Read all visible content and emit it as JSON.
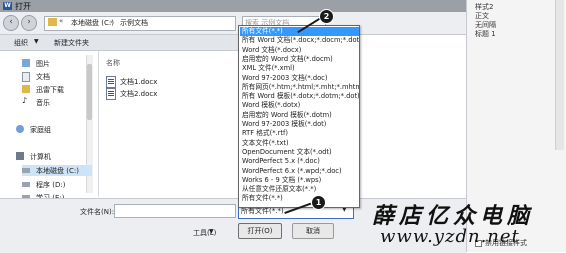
{
  "window": {
    "title": "打开"
  },
  "address": {
    "arrow": "«",
    "drive": "本地磁盘 (C:)",
    "separator": "›",
    "folder": "示例文档",
    "search_placeholder": "搜索 示例文档"
  },
  "toolbar": {
    "organize": "组织",
    "organize_arrow": "▼",
    "new_folder": "新建文件夹"
  },
  "nav": {
    "pictures": "图片",
    "documents": "文档",
    "xunlei": "迅雷下载",
    "music": "音乐",
    "homegroup": "家庭组",
    "computer": "计算机",
    "drive_c": "本地磁盘 (C:)",
    "drive_d": "程序 (D:)",
    "drive_e": "学习 (E:)"
  },
  "files": {
    "column_name": "名称",
    "items": [
      "文档1.docx",
      "文档2.docx"
    ]
  },
  "bottom": {
    "filename_label": "文件名(N):",
    "tools_label": "工具(L)",
    "tools_arrow": "▼",
    "open_button": "打开(O)",
    "cancel_button": "取消",
    "filetype_value": "所有文件(*.*)",
    "filetype_arrow": "▼"
  },
  "dropdown": {
    "options": [
      "所有文件(*.*)",
      "所有 Word 文档(*.docx;*.docm;*.dotx;*.dotm;*.doc;*.dot;*.htm;*.html;*.rtf;*.mht;*.mhtml;*.xml;*.odt)",
      "Word 文档(*.docx)",
      "启用宏的 Word 文档(*.docm)",
      "XML 文件(*.xml)",
      "Word 97-2003 文档(*.doc)",
      "所有网页(*.htm;*.html;*.mht;*.mhtml)",
      "所有 Word 模板(*.dotx;*.dotm;*.dot)",
      "Word 模板(*.dotx)",
      "启用宏的 Word 模板(*.dotm)",
      "Word 97-2003 模板(*.dot)",
      "RTF 格式(*.rtf)",
      "文本文件(*.txt)",
      "OpenDocument 文本(*.odt)",
      "WordPerfect 5.x (*.doc)",
      "WordPerfect 6.x (*.wpd;*.doc)",
      "Works 6 - 9 文档 (*.wps)",
      "从任意文件还原文本(*.*)",
      "所有文件(*.*)"
    ],
    "selected_index": 0
  },
  "markers": {
    "one": "1",
    "two": "2"
  },
  "right_panel": {
    "items": [
      "样式2",
      "正文",
      "无间隔",
      "标题 1"
    ],
    "checkbox_label": "禁用链接样式"
  },
  "watermark": {
    "title": "薛店亿众电脑",
    "url": "www.yzdn.net"
  },
  "colors": {
    "selection": "#3399ff",
    "accent": "#2b579a"
  }
}
